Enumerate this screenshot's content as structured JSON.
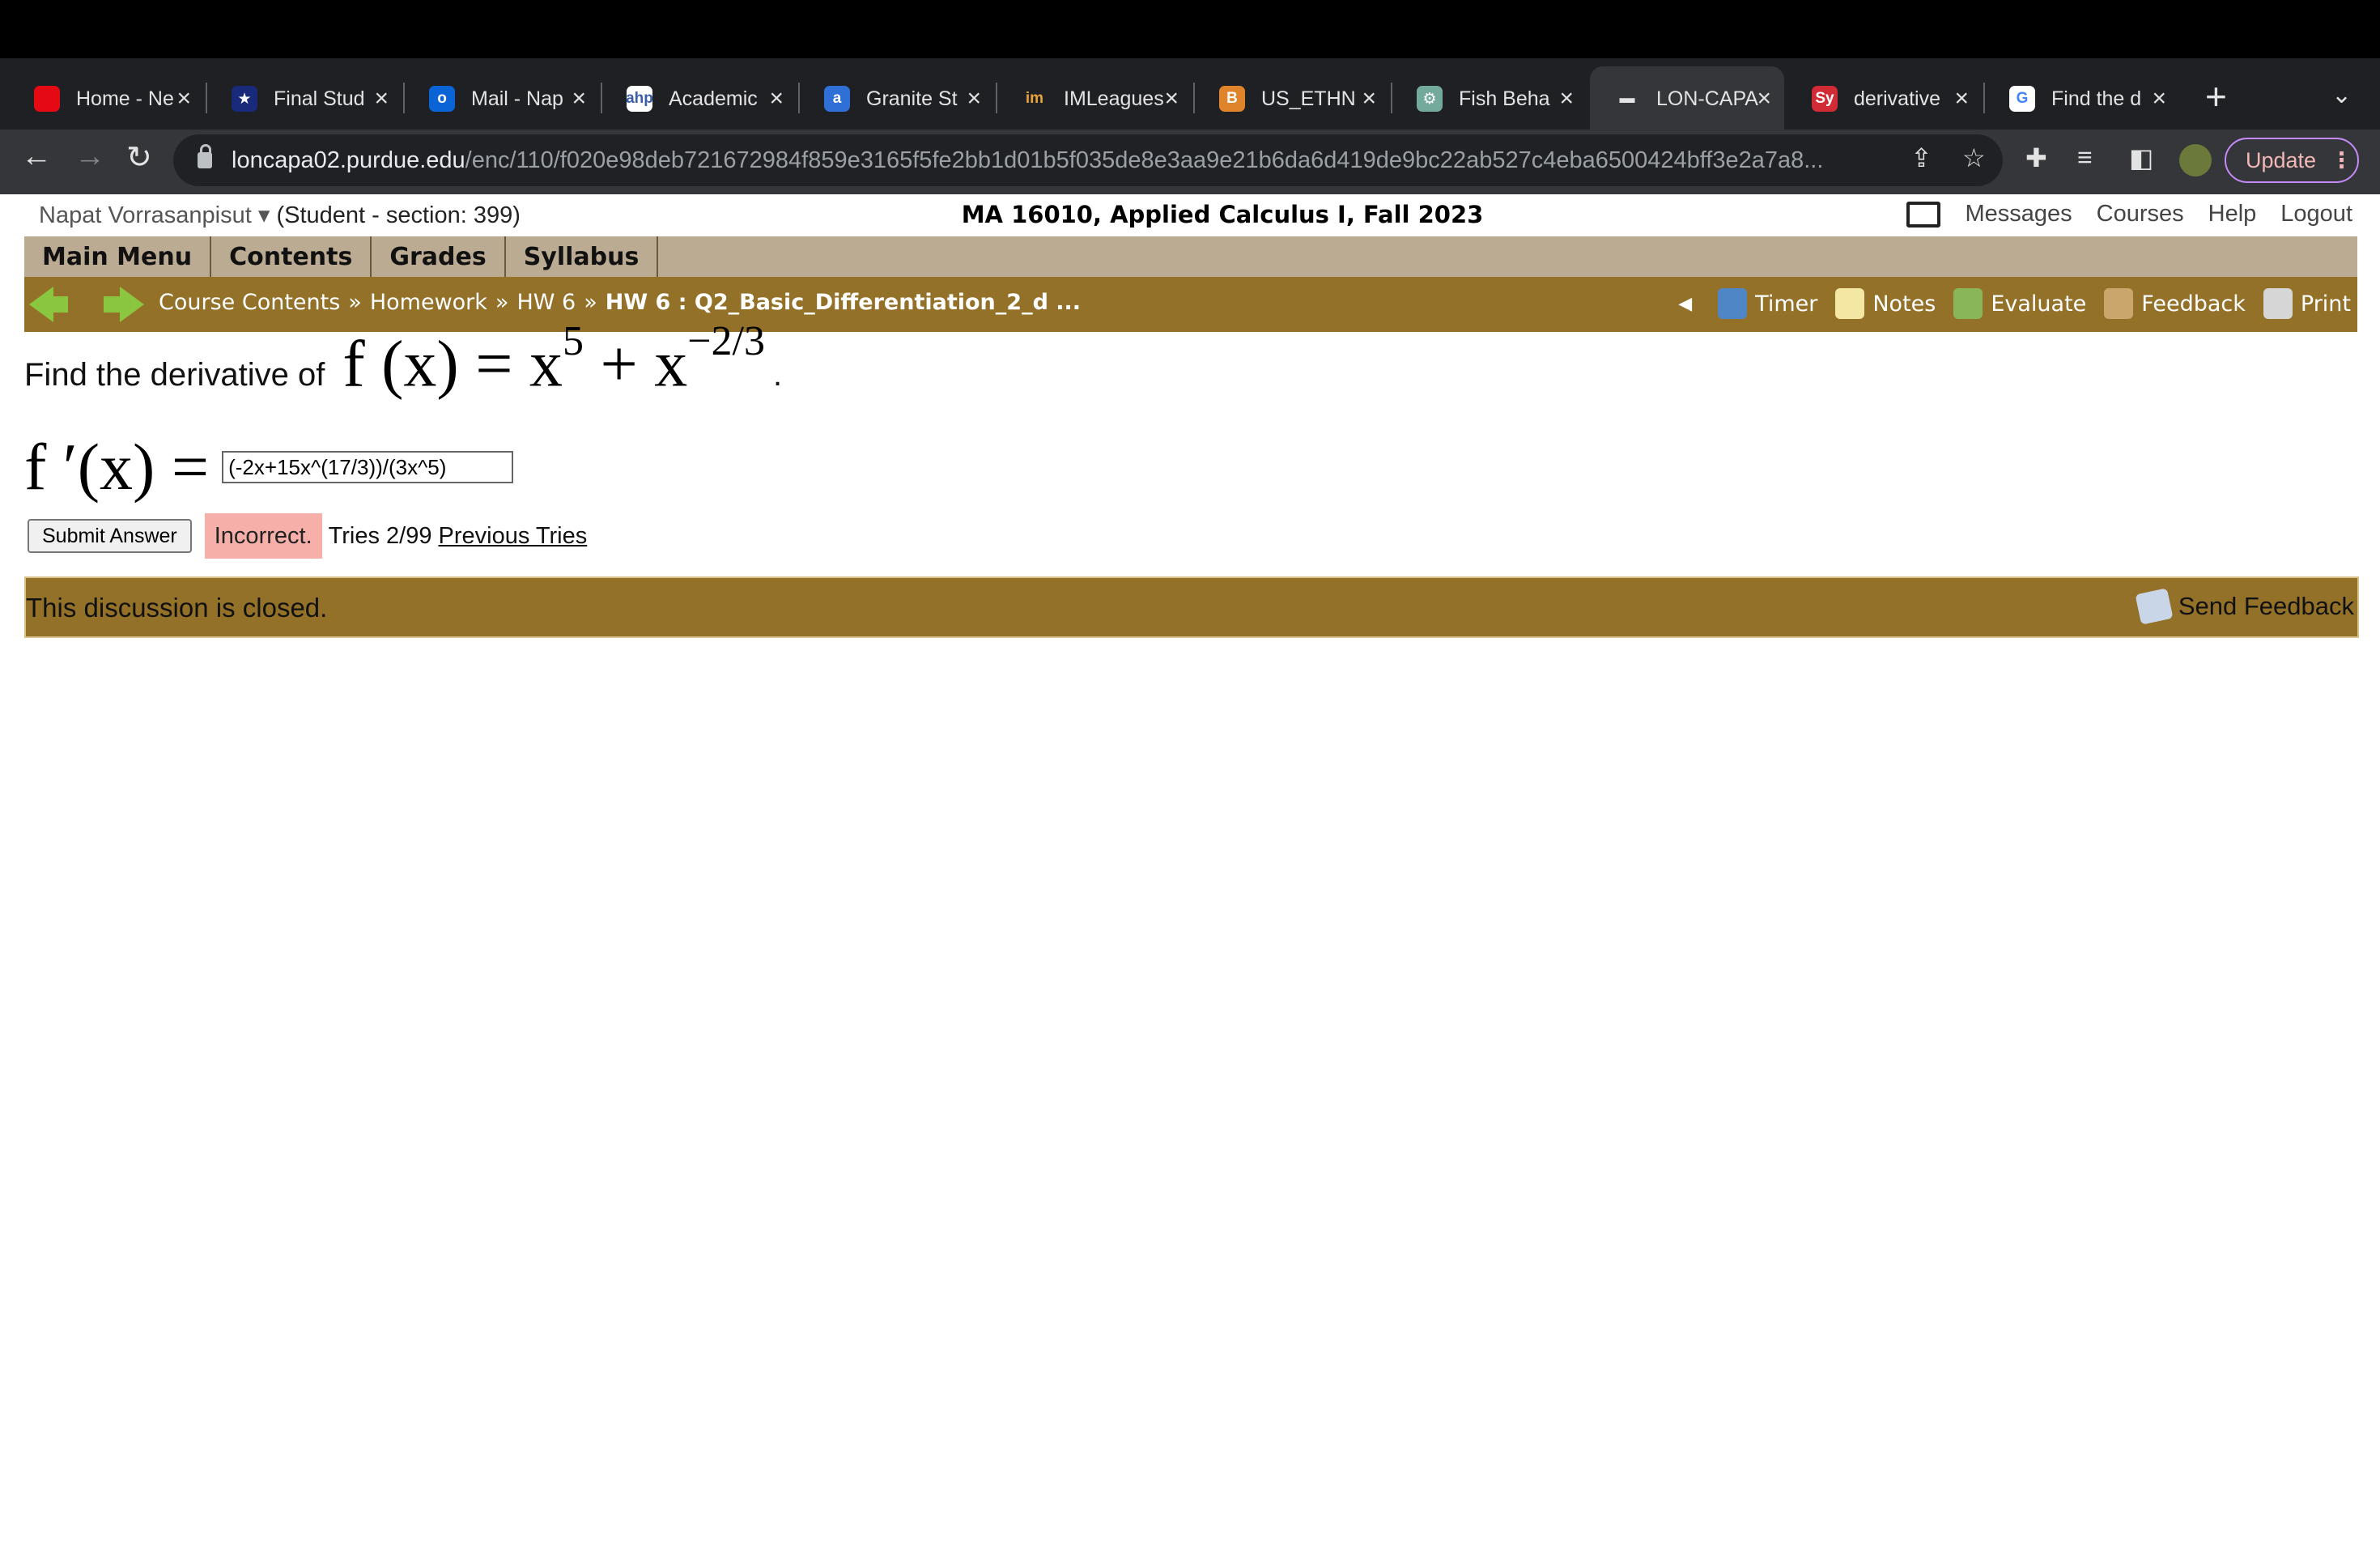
{
  "browser": {
    "tabs": [
      {
        "label": "Home - Ne",
        "icon": "netflix-icon",
        "icon_text": "N",
        "icon_color": "#e50914",
        "icon_fg": "#e50914"
      },
      {
        "label": "Final Stud",
        "icon": "star-icon",
        "icon_text": "★",
        "icon_color": "#1a2a7a",
        "icon_fg": "#ffffff"
      },
      {
        "label": "Mail - Nap",
        "icon": "outlook-icon",
        "icon_text": "o",
        "icon_color": "#0a64d6",
        "icon_fg": "#ffffff"
      },
      {
        "label": "Academic",
        "icon": "ahp-icon",
        "icon_text": "ahp",
        "icon_color": "#ffffff",
        "icon_fg": "#3a5ea8"
      },
      {
        "label": "Granite St",
        "icon": "granite-icon",
        "icon_text": "a",
        "icon_color": "#2f6fd6",
        "icon_fg": "#ffffff"
      },
      {
        "label": "IMLeagues",
        "icon": "imleagues-icon",
        "icon_text": "im",
        "icon_color": "#1f2023",
        "icon_fg": "#e8a33a"
      },
      {
        "label": "US_ETHN",
        "icon": "bitcoin-icon",
        "icon_text": "B",
        "icon_color": "#e0842b",
        "icon_fg": "#ffffff"
      },
      {
        "label": "Fish Beha",
        "icon": "chatgpt-icon",
        "icon_text": "⚙",
        "icon_color": "#74aa9c",
        "icon_fg": "#ffffff"
      },
      {
        "label": "LON-CAPA",
        "icon": "loncapa-icon",
        "icon_text": "▬",
        "icon_color": "#35363a",
        "icon_fg": "#e3e3e3",
        "active": true
      },
      {
        "label": "derivative",
        "icon": "symbolab-icon",
        "icon_text": "Sy",
        "icon_color": "#d12b35",
        "icon_fg": "#ffffff"
      },
      {
        "label": "Find the d",
        "icon": "google-icon",
        "icon_text": "G",
        "icon_color": "#ffffff",
        "icon_fg": "#4285f4"
      }
    ],
    "url_host": "loncapa02.purdue.edu",
    "url_path": "/enc/110/f020e98deb721672984f859e3165f5fe2bb1d01b5f035de8e3aa9e21b6da6d419de9bc22ab527c4eba6500424bff3e2a7a8...",
    "update_label": "Update"
  },
  "header": {
    "user_name": "Napat Vorrasanpisut",
    "user_role": "(Student  - section: 399)",
    "course_title": "MA 16010, Applied Calculus I, Fall 2023",
    "links": [
      "Messages",
      "Courses",
      "Help",
      "Logout"
    ]
  },
  "main_menu": [
    "Main Menu",
    "Contents",
    "Grades",
    "Syllabus"
  ],
  "breadcrumbs": [
    "Course Contents",
    "Homework",
    "HW 6"
  ],
  "breadcrumb_current": "HW 6 : Q2_Basic_Differentiation_2_d ...",
  "tools": [
    {
      "label": "Timer",
      "icon": "timer-icon",
      "color": "#4f86c6"
    },
    {
      "label": "Notes",
      "icon": "notes-icon",
      "color": "#f4e7a3"
    },
    {
      "label": "Evaluate",
      "icon": "evaluate-icon",
      "color": "#8ab65a"
    },
    {
      "label": "Feedback",
      "icon": "feedback-icon",
      "color": "#c9a66b"
    },
    {
      "label": "Print",
      "icon": "print-icon",
      "color": "#d6d6d6"
    }
  ],
  "problem": {
    "prompt": "Find the derivative of",
    "function_lhs": "f (x) = x",
    "exp1": "5",
    "function_mid": " + x",
    "exp2": "−2/3",
    "period": ".",
    "answer_lhs": "f ′(x) =",
    "answer_value": "(-2x+15x^(17/3))/(3x^5)",
    "submit_label": "Submit Answer",
    "status": "Incorrect.",
    "tries": "Tries 2/99",
    "previous_tries": "Previous Tries"
  },
  "discussion": {
    "text": "This discussion is closed.",
    "send_feedback": "Send Feedback"
  }
}
